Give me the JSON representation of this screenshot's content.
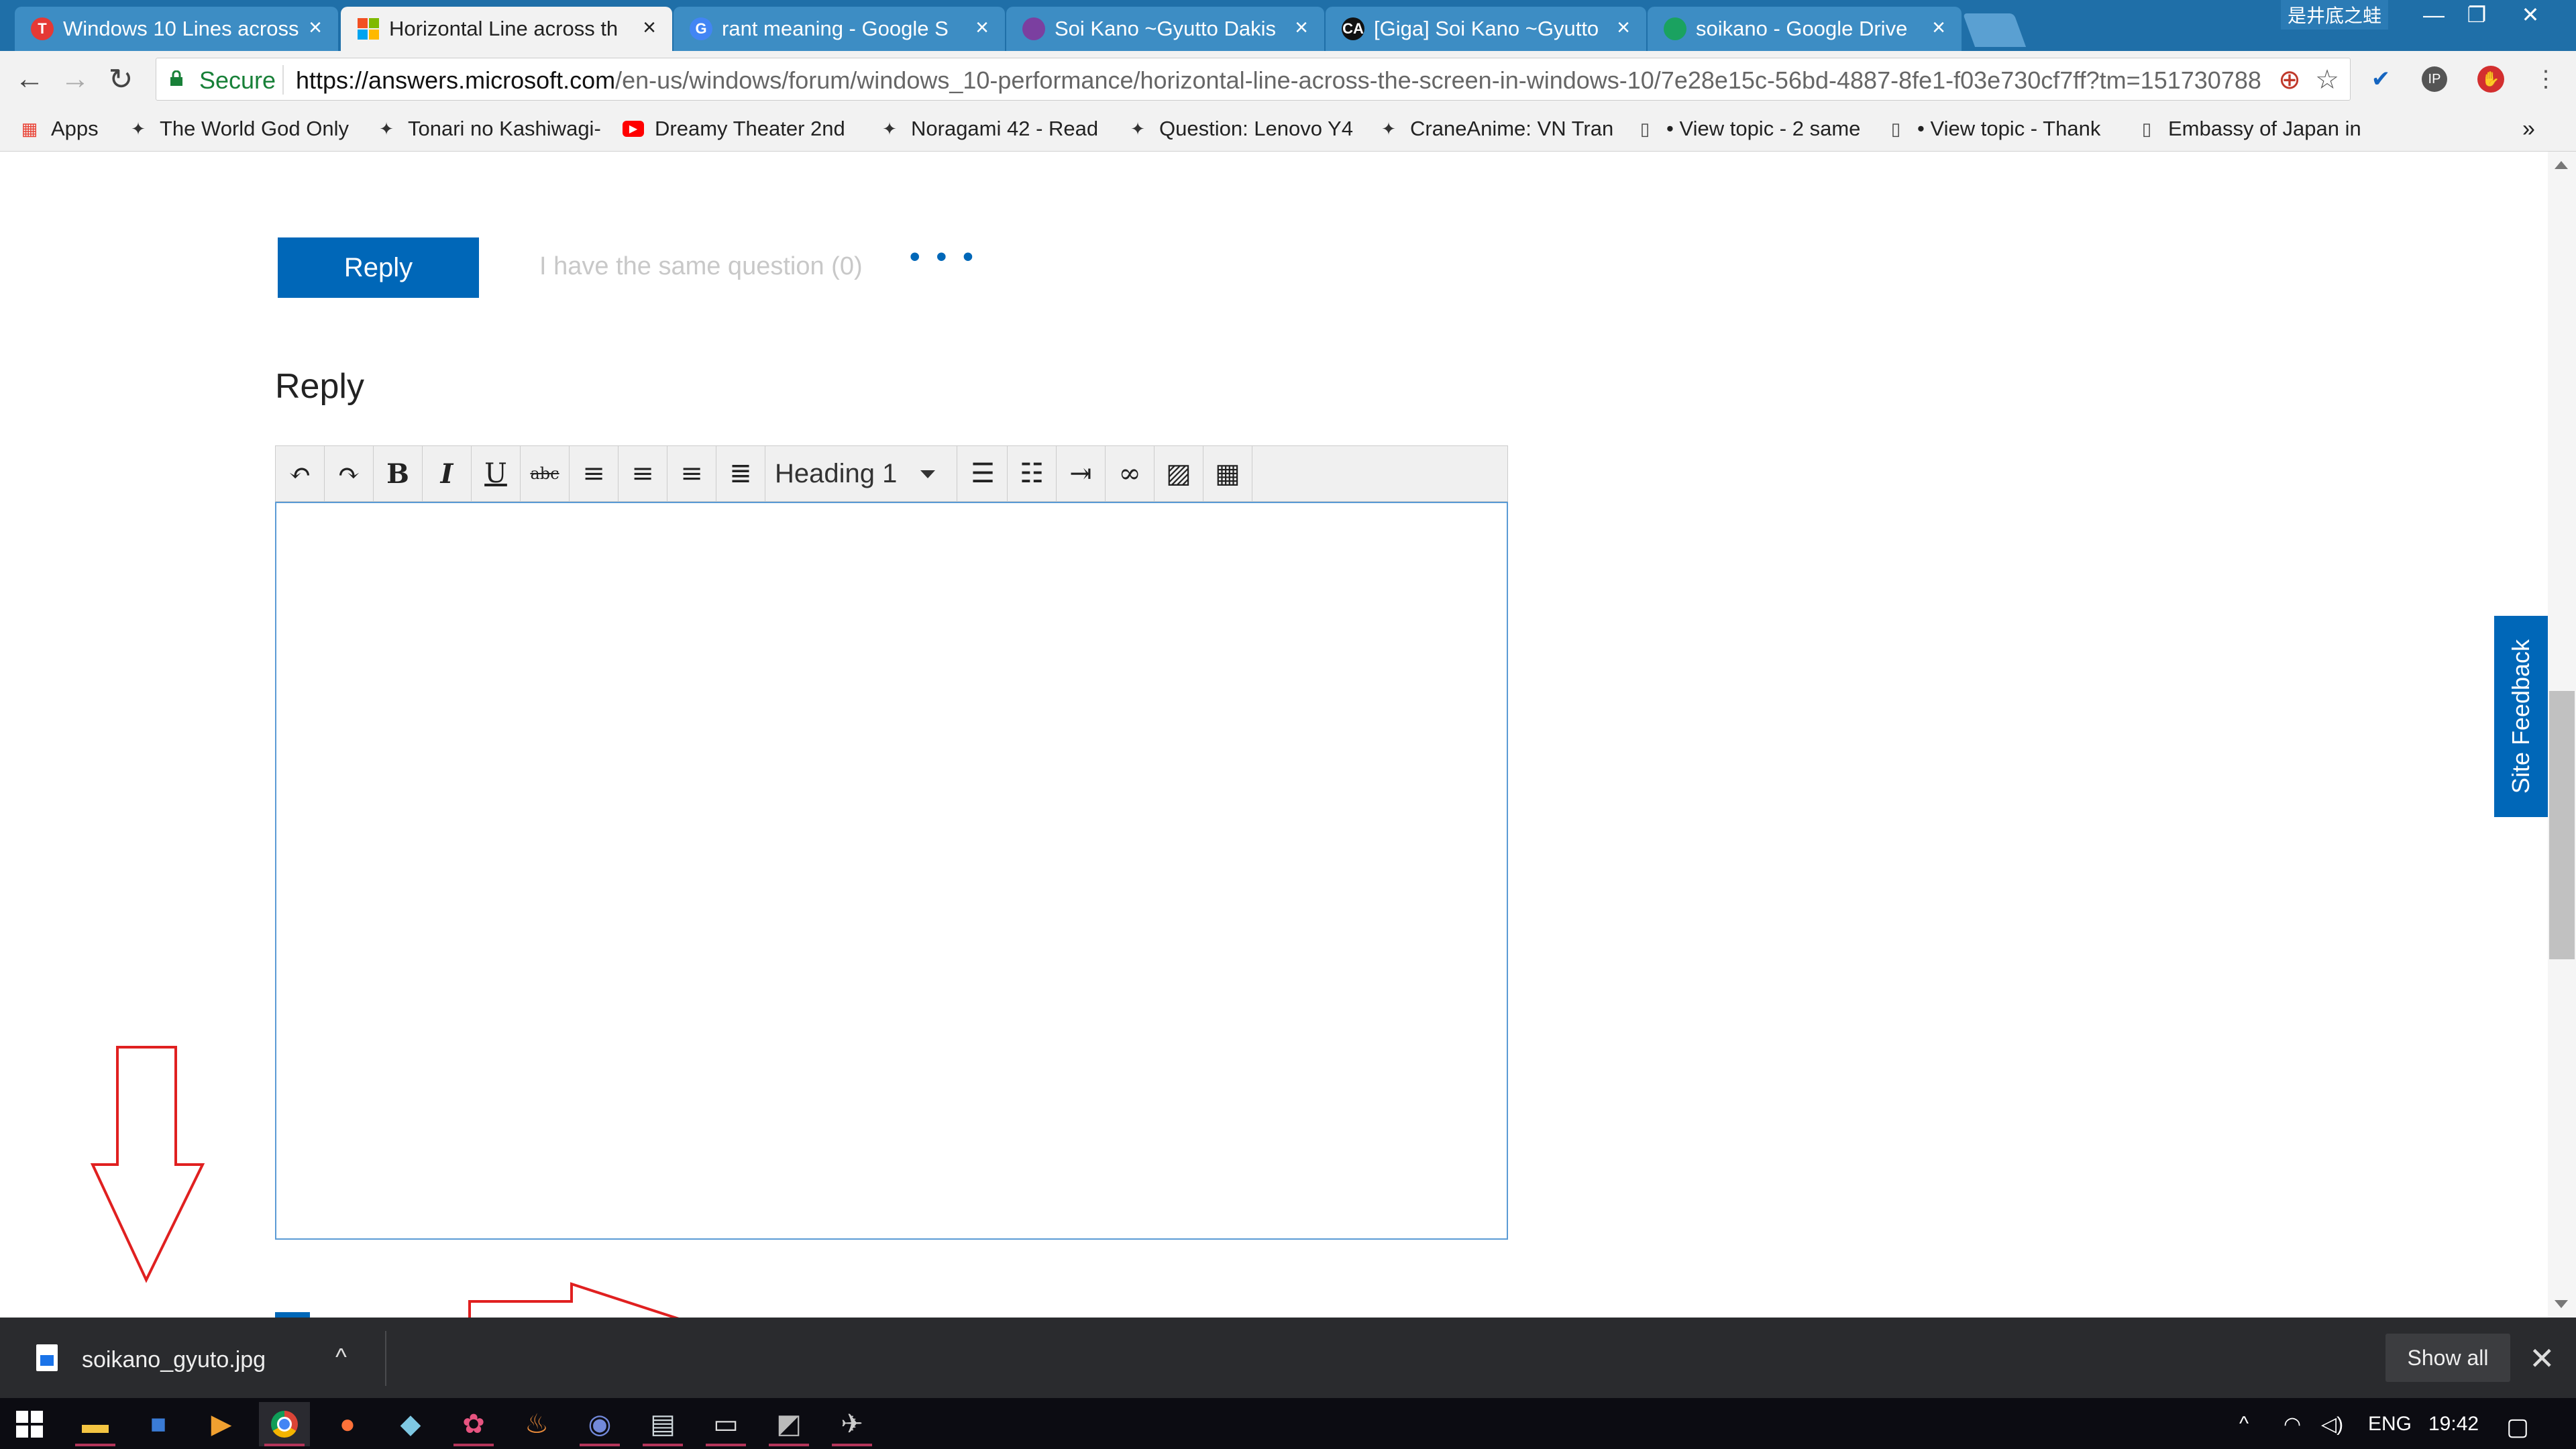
{
  "browser": {
    "tabs": [
      {
        "title": "Windows 10 Lines across",
        "favicon_color": "#e53935",
        "favicon_glyph": "T",
        "active": false
      },
      {
        "title": "Horizontal Line across th",
        "favicon_color": "#f25022",
        "favicon_glyph": "",
        "active": true
      },
      {
        "title": "rant meaning - Google S",
        "favicon_color": "#4285f4",
        "favicon_glyph": "G",
        "active": false
      },
      {
        "title": "Soi Kano ~Gyutto Dakis",
        "favicon_color": "#7b3fa0",
        "favicon_glyph": "",
        "active": false
      },
      {
        "title": "[Giga] Soi Kano ~Gyutto",
        "favicon_color": "#111111",
        "favicon_glyph": "CA",
        "active": false
      },
      {
        "title": "soikano - Google Drive",
        "favicon_color": "#1aa260",
        "favicon_glyph": "",
        "active": false
      }
    ],
    "ime_label": "是井底之蛙",
    "window_controls": {
      "minimize": "—",
      "restore": "❐",
      "close": "✕"
    },
    "security_label": "Secure",
    "url_host": "https://answers.microsoft.com",
    "url_path": "/en-us/windows/forum/windows_10-performance/horizontal-line-across-the-screen-in-windows-10/7e28e15c-56bd-4887-8fe1-f03e730cf7ff?tm=1517307888...",
    "bookmarks": [
      {
        "label": "Apps",
        "icon": "apps-grid-icon"
      },
      {
        "label": "The World God Only",
        "icon": "bookmark-icon"
      },
      {
        "label": "Tonari no Kashiwagi-",
        "icon": "bookmark-icon"
      },
      {
        "label": "Dreamy Theater 2nd",
        "icon": "youtube-icon"
      },
      {
        "label": "Noragami 42 - Read",
        "icon": "bookmark-icon"
      },
      {
        "label": "Question: Lenovo Y4",
        "icon": "bookmark-icon"
      },
      {
        "label": "CraneAnime: VN Tran",
        "icon": "bookmark-icon"
      },
      {
        "label": "• View topic - 2 same",
        "icon": "page-icon"
      },
      {
        "label": "• View topic - Thank",
        "icon": "page-icon"
      },
      {
        "label": "Embassy of Japan in",
        "icon": "page-icon"
      }
    ],
    "bookmarks_overflow": "»"
  },
  "page": {
    "reply_button": "Reply",
    "same_question": "I have the same question (0)",
    "more_options": "• • •",
    "reply_heading": "Reply",
    "editor": {
      "heading_select": "Heading 1",
      "buttons": [
        {
          "name": "undo",
          "glyph": "↶"
        },
        {
          "name": "redo",
          "glyph": "↷"
        },
        {
          "name": "bold",
          "glyph": "B"
        },
        {
          "name": "italic",
          "glyph": "I"
        },
        {
          "name": "underline",
          "glyph": "U"
        },
        {
          "name": "strikethrough",
          "glyph": "abc"
        },
        {
          "name": "align-left",
          "glyph": "≡"
        },
        {
          "name": "align-center",
          "glyph": "≡"
        },
        {
          "name": "align-right",
          "glyph": "≡"
        },
        {
          "name": "justify",
          "glyph": "≣"
        }
      ],
      "buttons2": [
        {
          "name": "bulleted-list",
          "glyph": "☰"
        },
        {
          "name": "numbered-list",
          "glyph": "☷"
        },
        {
          "name": "indent",
          "glyph": "⇥"
        },
        {
          "name": "link",
          "glyph": "∞"
        },
        {
          "name": "image",
          "glyph": "▨"
        },
        {
          "name": "table",
          "glyph": "▦"
        }
      ]
    },
    "site_feedback": "Site Feedback"
  },
  "download": {
    "filename": "soikano_gyuto.jpg",
    "caret": "^",
    "show_all": "Show all",
    "close": "✕"
  },
  "taskbar": {
    "language": "ENG",
    "time": "19:42"
  },
  "colors": {
    "accent": "#0067b8",
    "annotation_arrow": "#e02020"
  }
}
